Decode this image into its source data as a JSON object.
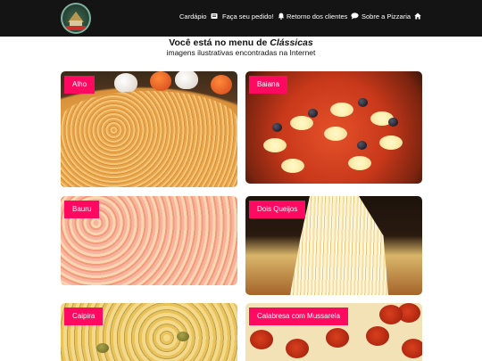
{
  "nav": {
    "items": [
      {
        "label": "Cardápio",
        "icon": "menu-book-icon"
      },
      {
        "label": "Faça seu pedido!",
        "icon": "bell-icon"
      },
      {
        "label": "Retorno dos clientes",
        "icon": "comment-icon"
      },
      {
        "label": "Sobre a Pizzaria",
        "icon": "home-icon"
      }
    ]
  },
  "page": {
    "heading_prefix": "Você está no menu de ",
    "heading_category": "Clássicas",
    "subheading": "imagens ilustrativas encontradas na Internet"
  },
  "pizzas": [
    {
      "name": "Alho"
    },
    {
      "name": "Baiana"
    },
    {
      "name": "Bauru"
    },
    {
      "name": "Dois Queijos"
    },
    {
      "name": "Caipira"
    },
    {
      "name": "Calabresa com Mussarela"
    }
  ],
  "colors": {
    "navbar": "#141414",
    "badge": "#ff0a60",
    "badge_text": "#ffffff"
  }
}
